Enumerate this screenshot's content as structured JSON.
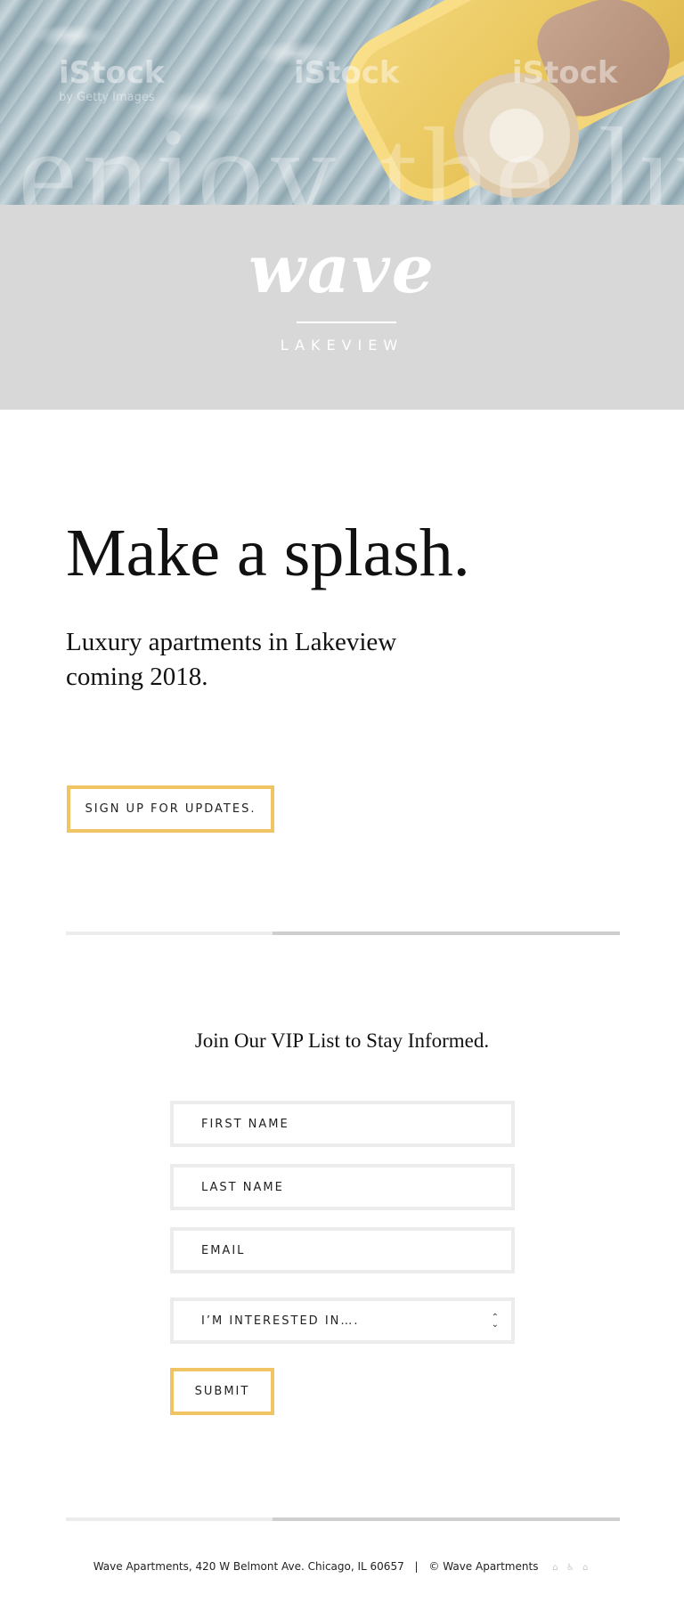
{
  "hero": {
    "watermarks": [
      "iStock",
      "iStock",
      "iStock"
    ],
    "watermark_credit": "by Getty Images",
    "overlay_word": "enjoy the lux"
  },
  "logo": {
    "wordmark": "wave",
    "location": "LAKEVIEW"
  },
  "intro": {
    "headline": "Make a splash.",
    "subline": "Luxury apartments in Lakeview coming 2018.",
    "cta_label": "SIGN UP FOR UPDATES."
  },
  "vip_form": {
    "title": "Join Our VIP List to Stay Informed.",
    "first_name_placeholder": "FIRST NAME",
    "last_name_placeholder": "LAST NAME",
    "email_placeholder": "EMAIL",
    "interest_select": "I’M INTERESTED IN….",
    "submit_label": "SUBMIT"
  },
  "footer": {
    "address": "Wave Apartments, 420 W Belmont Ave. Chicago, IL 60657",
    "separator": "|",
    "copyright": "© Wave Apartments",
    "housing_icons": "⌂ ♿ ⌂"
  },
  "colors": {
    "accent_gold": "#f0c462",
    "logo_band": "#d8d8d8",
    "field_border": "#ececec"
  }
}
